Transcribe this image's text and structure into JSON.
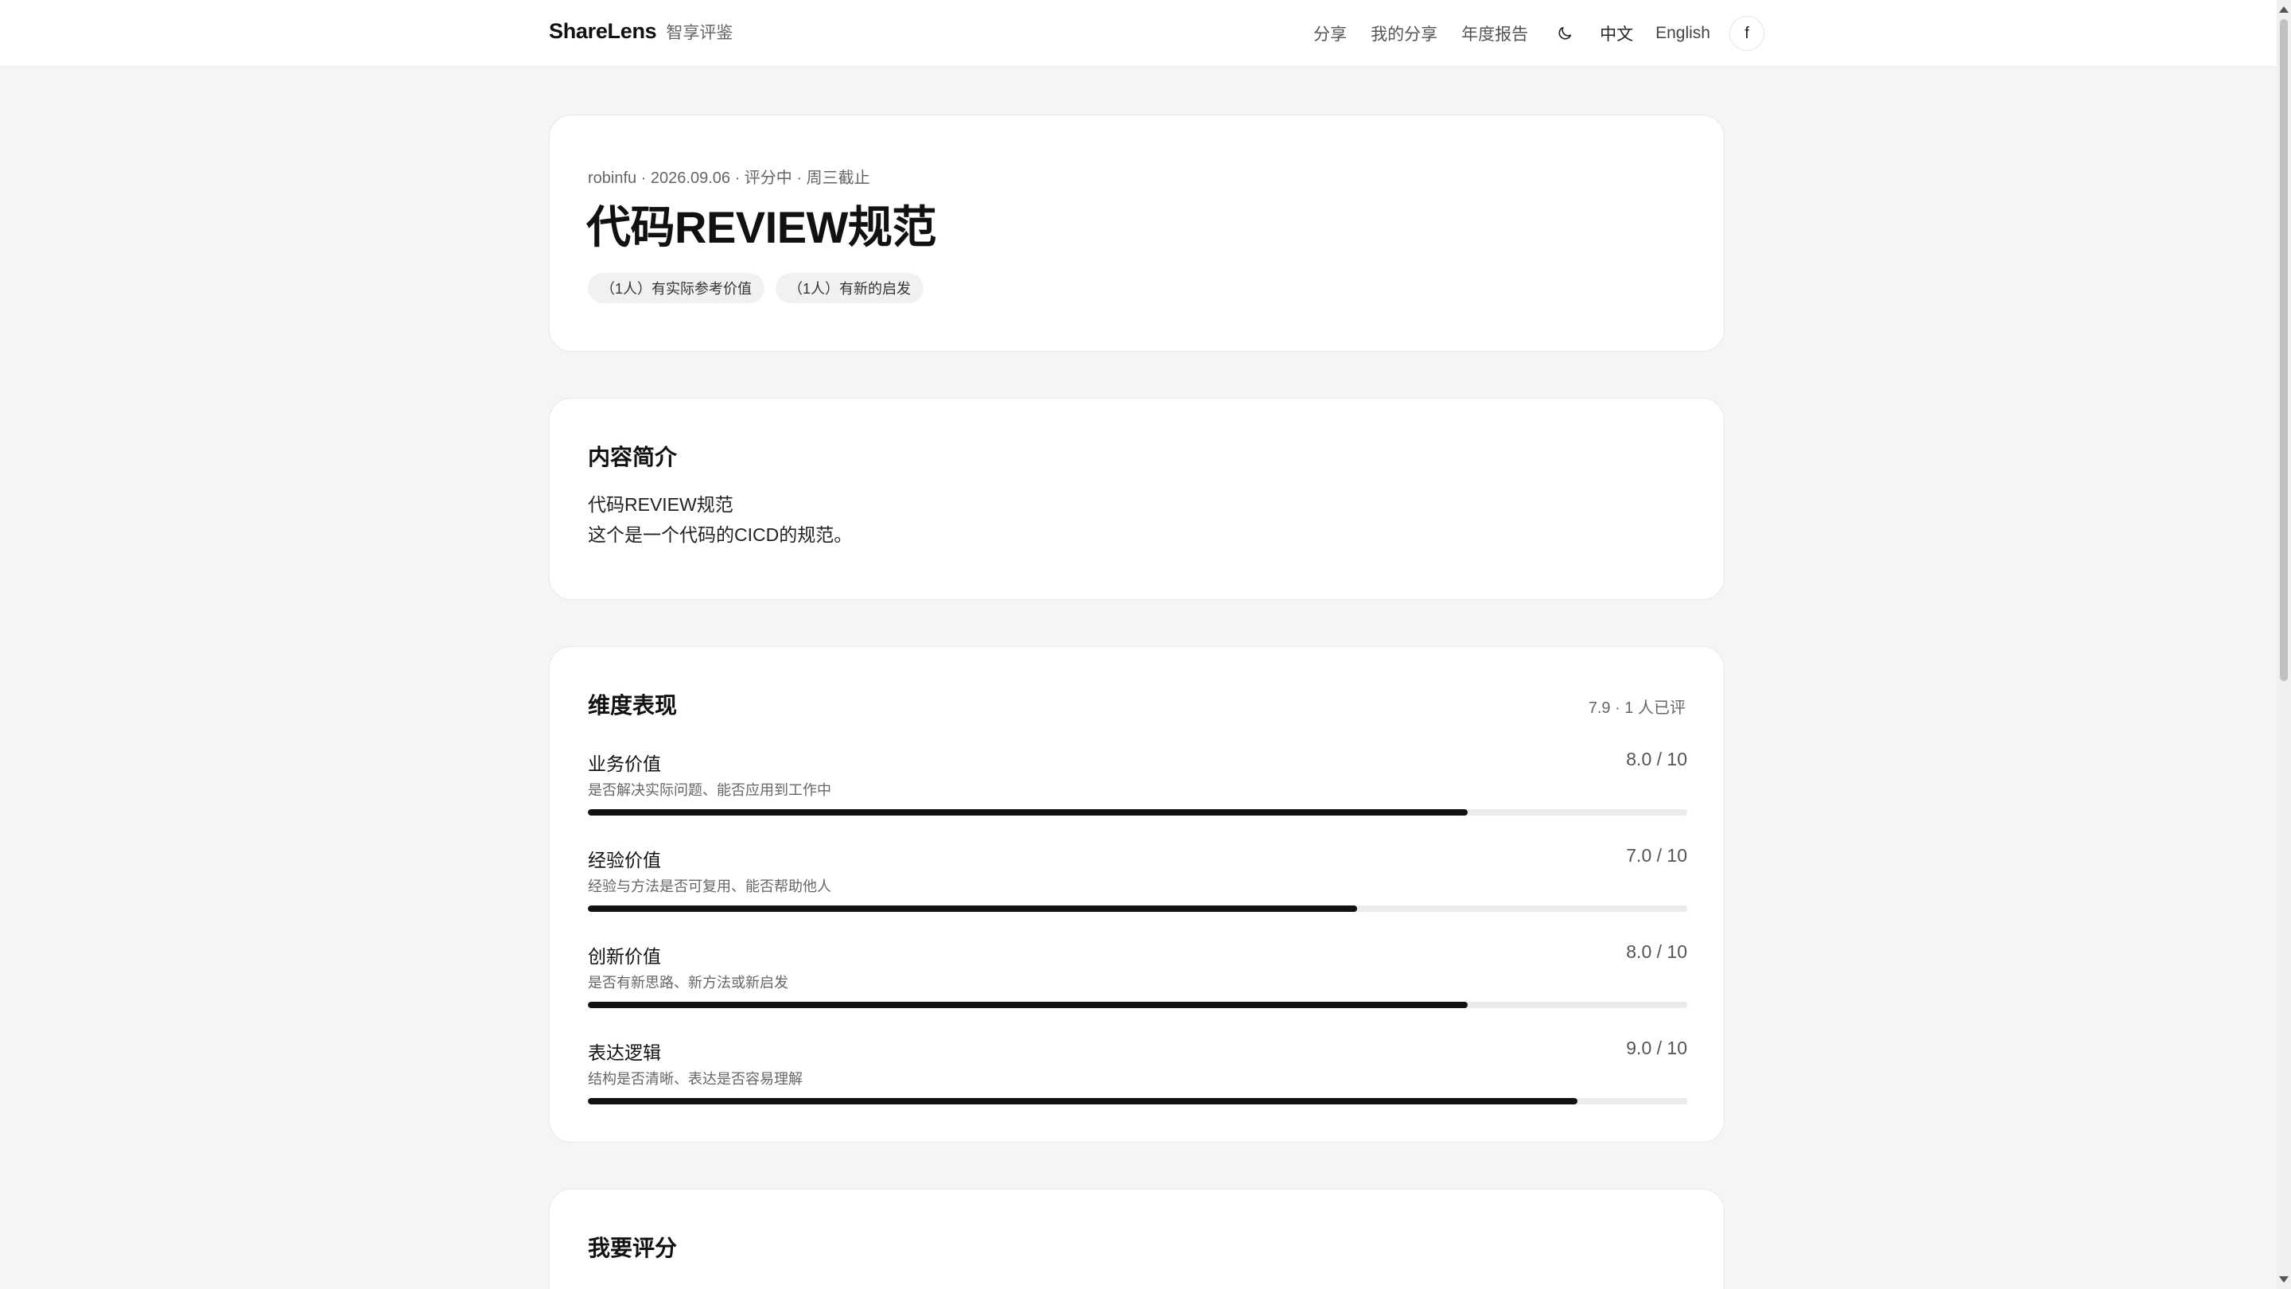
{
  "header": {
    "brand_name": "ShareLens",
    "brand_sub": "智享评鉴",
    "nav": [
      "分享",
      "我的分享",
      "年度报告"
    ],
    "theme_icon": "moon-icon",
    "lang_zh": "中文",
    "lang_en": "English",
    "user_initial": "f"
  },
  "share": {
    "meta": "robinfu · 2026.09.06 · 评分中 · 周三截止",
    "title": "代码REVIEW规范",
    "tags": [
      "（1人）有实际参考价值",
      "（1人）有新的启发"
    ]
  },
  "intro": {
    "heading": "内容简介",
    "lines": [
      "代码REVIEW规范",
      "这个是一个代码的CICD的规范。"
    ]
  },
  "dimensions": {
    "heading": "维度表现",
    "summary": "7.9 · 1 人已评",
    "items": [
      {
        "name": "业务价值",
        "desc": "是否解决实际问题、能否应用到工作中",
        "score_text": "8.0 / 10",
        "score": 8.0,
        "max": 10
      },
      {
        "name": "经验价值",
        "desc": "经验与方法是否可复用、能否帮助他人",
        "score_text": "7.0 / 10",
        "score": 7.0,
        "max": 10
      },
      {
        "name": "创新价值",
        "desc": "是否有新思路、新方法或新启发",
        "score_text": "8.0 / 10",
        "score": 8.0,
        "max": 10
      },
      {
        "name": "表达逻辑",
        "desc": "结构是否清晰、表达是否容易理解",
        "score_text": "9.0 / 10",
        "score": 9.0,
        "max": 10
      }
    ]
  },
  "rating": {
    "heading": "我要评分"
  },
  "colors": {
    "page_bg": "#f5f5f6",
    "bar_fill": "#111111",
    "bar_track": "#ebebed"
  }
}
